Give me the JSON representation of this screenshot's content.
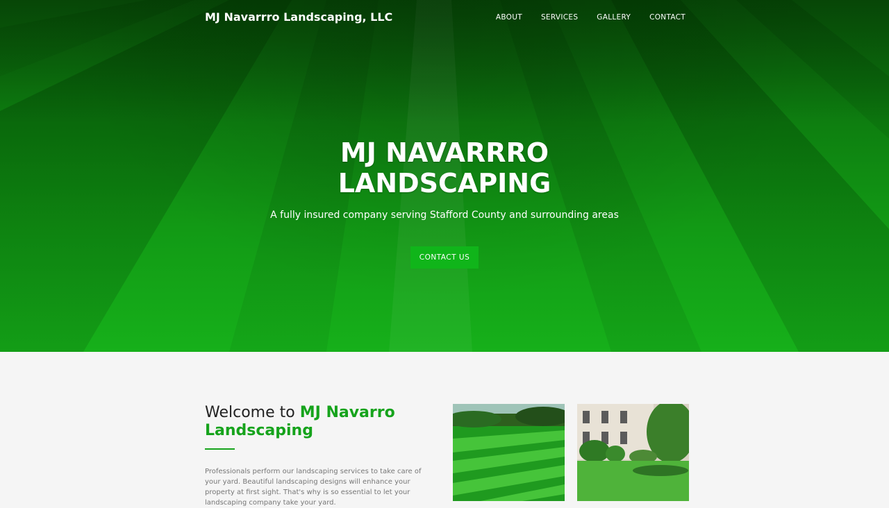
{
  "nav": {
    "brand": "MJ Navarrro Landscaping, LLC",
    "items": [
      {
        "label": "ABOUT"
      },
      {
        "label": "SERVICES"
      },
      {
        "label": "GALLERY"
      },
      {
        "label": "CONTACT"
      }
    ]
  },
  "hero": {
    "title": "MJ NAVARRRO LANDSCAPING",
    "subtitle": "A fully insured company serving Stafford County and surrounding areas",
    "cta_label": "CONTACT US"
  },
  "welcome": {
    "title_prefix": "Welcome to",
    "title_accent": "MJ Navarro Landscaping",
    "body": "Professionals perform our landscaping services to take care of your yard. Beautiful landscaping designs will enhance your property at first sight. That's why is so essential to let your landscaping company take your yard."
  },
  "colors": {
    "accent": "#16a31c",
    "button": "#10b51a"
  }
}
